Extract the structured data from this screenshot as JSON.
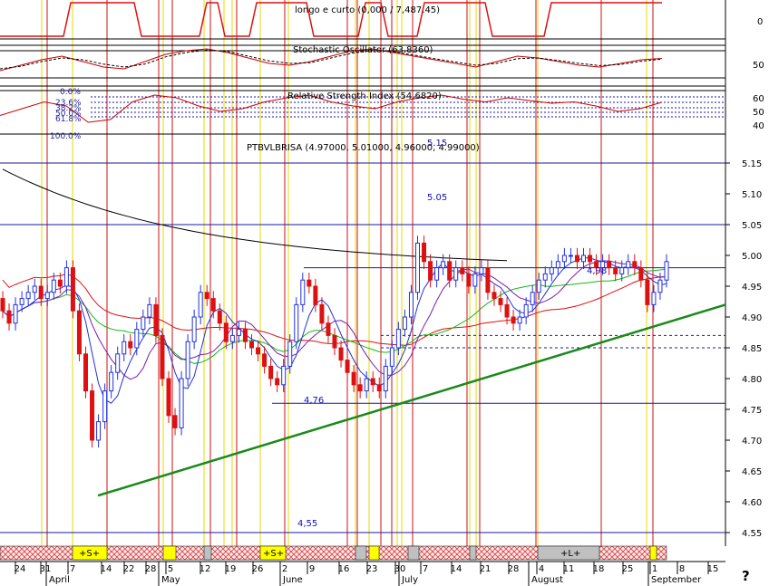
{
  "chart_data": [
    {
      "type": "line",
      "panel": "top-indicator",
      "title": "longo e curto (0,000 / 7,487.45)",
      "ylim": [
        -1,
        1
      ],
      "yticks": [
        0
      ],
      "series": []
    },
    {
      "type": "line",
      "panel": "stochastic",
      "title": "Stochastic Oscillator (63.8360)",
      "ylim": [
        0,
        100
      ],
      "yticks": [
        50
      ],
      "series": [
        {
          "name": "%K",
          "color": "#cc0000",
          "values": [
            30,
            45,
            60,
            70,
            55,
            40,
            35,
            55,
            75,
            85,
            90,
            80,
            65,
            50,
            45,
            55,
            70,
            85,
            90,
            80,
            70,
            60,
            50,
            40,
            55,
            70,
            65,
            55,
            45,
            40,
            50,
            60,
            63.8
          ]
        },
        {
          "name": "%D",
          "color": "#000000",
          "values": [
            35,
            42,
            55,
            65,
            60,
            48,
            40,
            48,
            68,
            80,
            87,
            83,
            70,
            57,
            50,
            52,
            65,
            78,
            86,
            83,
            73,
            63,
            54,
            45,
            50,
            63,
            65,
            58,
            50,
            44,
            47,
            56,
            62
          ]
        }
      ]
    },
    {
      "type": "line",
      "panel": "rsi",
      "title": "Relative Strength Index (54.6820)",
      "ylim": [
        30,
        70
      ],
      "yticks": [
        60,
        50,
        40
      ],
      "fib_labels": [
        "0.0%",
        "23.6%",
        "38.2%",
        "50.0%",
        "61.8%",
        "100.0%"
      ],
      "series": [
        {
          "name": "RSI",
          "color": "#cc0000",
          "values": [
            45,
            50,
            55,
            52,
            40,
            42,
            55,
            60,
            58,
            52,
            48,
            50,
            55,
            58,
            60,
            55,
            52,
            50,
            55,
            58,
            60,
            57,
            55,
            58,
            56,
            54,
            55,
            52,
            48,
            50,
            54.7
          ]
        }
      ]
    },
    {
      "type": "candlestick",
      "panel": "price",
      "title": "PTBVLBRISA (4.97000, 5.01000, 4.96000, 4.99000)",
      "ylim": [
        4.5,
        5.2
      ],
      "yticks": [
        5.15,
        5.1,
        5.05,
        5.0,
        4.95,
        4.9,
        4.85,
        4.8,
        4.75,
        4.7,
        4.65,
        4.6,
        4.55
      ],
      "x_day_labels": [
        "24",
        "31",
        "7",
        "14",
        "22",
        "28",
        "5",
        "12",
        "19",
        "26",
        "2",
        "9",
        "16",
        "23",
        "30",
        "7",
        "14",
        "21",
        "28",
        "4",
        "11",
        "18",
        "25",
        "1",
        "8",
        "15"
      ],
      "x_month_labels": [
        "April",
        "May",
        "June",
        "July",
        "August",
        "September"
      ],
      "annotations": [
        "5.05",
        "4,76",
        "4,55",
        "4,98",
        "5.15"
      ],
      "hlines": [
        5.15,
        5.05,
        4.76,
        4.55,
        4.98,
        4.87,
        4.85
      ],
      "trendline": {
        "from": [
          1,
          4.61
        ],
        "to": [
          126,
          4.92
        ]
      },
      "closes": [
        4.91,
        4.89,
        4.92,
        4.93,
        4.94,
        4.95,
        4.93,
        4.94,
        4.96,
        4.95,
        4.98,
        4.91,
        4.84,
        4.78,
        4.7,
        4.73,
        4.78,
        4.81,
        4.84,
        4.86,
        4.85,
        4.88,
        4.9,
        4.92,
        4.87,
        4.8,
        4.74,
        4.72,
        4.8,
        4.86,
        4.9,
        4.94,
        4.93,
        4.91,
        4.89,
        4.86,
        4.87,
        4.88,
        4.86,
        4.85,
        4.84,
        4.82,
        4.8,
        4.79,
        4.82,
        4.86,
        4.92,
        4.96,
        4.95,
        4.92,
        4.89,
        4.87,
        4.85,
        4.83,
        4.81,
        4.79,
        4.78,
        4.8,
        4.79,
        4.78,
        4.82,
        4.85,
        4.88,
        4.9,
        4.94,
        5.02,
        4.99,
        4.96,
        4.98,
        4.99,
        4.96,
        4.98,
        4.97,
        4.95,
        4.97,
        4.98,
        4.94,
        4.93,
        4.92,
        4.9,
        4.89,
        4.9,
        4.92,
        4.94,
        4.96,
        4.97,
        4.98,
        4.99,
        5.0,
        5.0,
        4.99,
        5.0,
        4.99,
        4.98,
        4.99,
        4.98,
        4.97,
        4.98,
        4.99,
        4.98,
        4.96,
        4.92,
        4.94,
        4.96,
        4.99
      ],
      "series": [
        {
          "name": "MA-200",
          "color": "#000000"
        },
        {
          "name": "MA-50",
          "color": "#dd1111"
        },
        {
          "name": "MA-20",
          "color": "#11bb11"
        },
        {
          "name": "MA-9",
          "color": "#7a1fb0"
        },
        {
          "name": "MA-5",
          "color": "#2233dd"
        }
      ]
    }
  ],
  "signal_bar": {
    "labels": [
      "+S+",
      "+S+",
      "+L+"
    ]
  },
  "corner_symbol": "?"
}
